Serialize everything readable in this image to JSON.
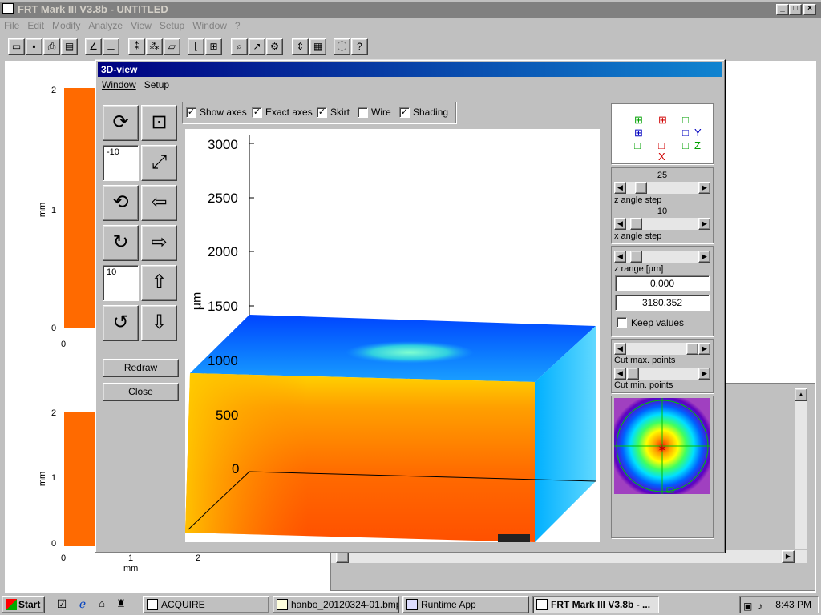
{
  "app": {
    "title": "FRT Mark III V3.8b - UNTITLED",
    "menu": [
      "File",
      "Edit",
      "Modify",
      "Analyze",
      "View",
      "Setup",
      "Window",
      "?"
    ]
  },
  "background_plots": {
    "top": {
      "y_ticks": [
        "2",
        "1",
        "0"
      ],
      "x_tick": "0",
      "ylabel": "mm"
    },
    "bottom": {
      "y_ticks": [
        "2",
        "1",
        "0"
      ],
      "x_ticks": [
        "0",
        "1",
        "2"
      ],
      "ylabel": "mm",
      "xlabel": "mm"
    }
  },
  "dialog": {
    "title": "3D-view",
    "menu": [
      "Window",
      "Setup"
    ],
    "x_angle_value": "-10",
    "z_angle_value": "10",
    "redraw_label": "Redraw",
    "close_label": "Close",
    "options": [
      {
        "label": "Show axes",
        "checked": true
      },
      {
        "label": "Exact axes",
        "checked": true
      },
      {
        "label": "Skirt",
        "checked": true
      },
      {
        "label": "Wire",
        "checked": false
      },
      {
        "label": "Shading",
        "checked": true
      }
    ],
    "plot": {
      "z_ticks": [
        "3000",
        "2500",
        "2000",
        "1500",
        "1000",
        "500",
        "0"
      ],
      "z_unit": "μm"
    },
    "axis_selector": {
      "y_label": "Y",
      "z_label": "Z",
      "x_label": "X"
    },
    "z_angle_step": {
      "value": "25",
      "label": "z angle step"
    },
    "x_angle_step": {
      "value": "10",
      "label": "x angle step"
    },
    "z_range": {
      "label": "z range [µm]",
      "min": "0.000",
      "max": "3180.352"
    },
    "keep_values_label": "Keep values",
    "cut_max_label": "Cut max. points",
    "cut_min_label": "Cut min. points"
  },
  "taskbar": {
    "start_label": "Start",
    "tasks": [
      "ACQUIRE",
      "hanbo_20120324-01.bmp ...",
      "Runtime App",
      "FRT Mark III V3.8b - ..."
    ],
    "clock": "8:43 PM"
  }
}
